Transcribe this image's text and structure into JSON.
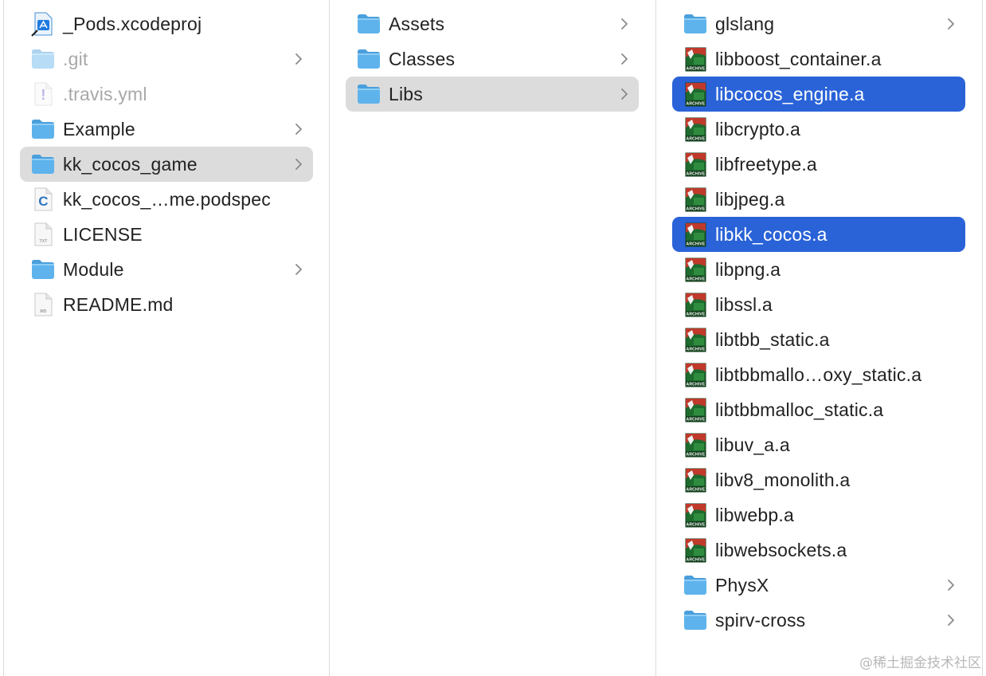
{
  "columns": [
    {
      "items": [
        {
          "label": "_Pods.xcodeproj",
          "icon": "xcodeproj-icon",
          "chevron": false,
          "dim": false,
          "selected": "none"
        },
        {
          "label": ".git",
          "icon": "folder-icon",
          "chevron": true,
          "dim": true,
          "selected": "none"
        },
        {
          "label": ".travis.yml",
          "icon": "yml-file-icon",
          "chevron": false,
          "dim": true,
          "selected": "none"
        },
        {
          "label": "Example",
          "icon": "folder-icon",
          "chevron": true,
          "dim": false,
          "selected": "none"
        },
        {
          "label": "kk_cocos_game",
          "icon": "folder-icon",
          "chevron": true,
          "dim": false,
          "selected": "gray"
        },
        {
          "label": "kk_cocos_…me.podspec",
          "icon": "podspec-file-icon",
          "chevron": false,
          "dim": false,
          "selected": "none"
        },
        {
          "label": "LICENSE",
          "icon": "text-file-icon",
          "chevron": false,
          "dim": false,
          "selected": "none"
        },
        {
          "label": "Module",
          "icon": "folder-icon",
          "chevron": true,
          "dim": false,
          "selected": "none"
        },
        {
          "label": "README.md",
          "icon": "text-file-icon",
          "chevron": false,
          "dim": false,
          "selected": "none"
        }
      ]
    },
    {
      "items": [
        {
          "label": "Assets",
          "icon": "folder-icon",
          "chevron": true,
          "dim": false,
          "selected": "none"
        },
        {
          "label": "Classes",
          "icon": "folder-icon",
          "chevron": true,
          "dim": false,
          "selected": "none"
        },
        {
          "label": "Libs",
          "icon": "folder-icon",
          "chevron": true,
          "dim": false,
          "selected": "gray"
        }
      ]
    },
    {
      "items": [
        {
          "label": "glslang",
          "icon": "folder-icon",
          "chevron": true,
          "dim": false,
          "selected": "none"
        },
        {
          "label": "libboost_container.a",
          "icon": "archive-icon",
          "chevron": false,
          "dim": false,
          "selected": "none"
        },
        {
          "label": "libcocos_engine.a",
          "icon": "archive-icon",
          "chevron": false,
          "dim": false,
          "selected": "blue"
        },
        {
          "label": "libcrypto.a",
          "icon": "archive-icon",
          "chevron": false,
          "dim": false,
          "selected": "none"
        },
        {
          "label": "libfreetype.a",
          "icon": "archive-icon",
          "chevron": false,
          "dim": false,
          "selected": "none"
        },
        {
          "label": "libjpeg.a",
          "icon": "archive-icon",
          "chevron": false,
          "dim": false,
          "selected": "none"
        },
        {
          "label": "libkk_cocos.a",
          "icon": "archive-icon",
          "chevron": false,
          "dim": false,
          "selected": "blue"
        },
        {
          "label": "libpng.a",
          "icon": "archive-icon",
          "chevron": false,
          "dim": false,
          "selected": "none"
        },
        {
          "label": "libssl.a",
          "icon": "archive-icon",
          "chevron": false,
          "dim": false,
          "selected": "none"
        },
        {
          "label": "libtbb_static.a",
          "icon": "archive-icon",
          "chevron": false,
          "dim": false,
          "selected": "none"
        },
        {
          "label": "libtbbmallo…oxy_static.a",
          "icon": "archive-icon",
          "chevron": false,
          "dim": false,
          "selected": "none"
        },
        {
          "label": "libtbbmalloc_static.a",
          "icon": "archive-icon",
          "chevron": false,
          "dim": false,
          "selected": "none"
        },
        {
          "label": "libuv_a.a",
          "icon": "archive-icon",
          "chevron": false,
          "dim": false,
          "selected": "none"
        },
        {
          "label": "libv8_monolith.a",
          "icon": "archive-icon",
          "chevron": false,
          "dim": false,
          "selected": "none"
        },
        {
          "label": "libwebp.a",
          "icon": "archive-icon",
          "chevron": false,
          "dim": false,
          "selected": "none"
        },
        {
          "label": "libwebsockets.a",
          "icon": "archive-icon",
          "chevron": false,
          "dim": false,
          "selected": "none"
        },
        {
          "label": "PhysX",
          "icon": "folder-icon",
          "chevron": true,
          "dim": false,
          "selected": "none"
        },
        {
          "label": "spirv-cross",
          "icon": "folder-icon",
          "chevron": true,
          "dim": false,
          "selected": "none"
        }
      ]
    }
  ],
  "icon_badges": {
    "podspec": "C",
    "text_file": "TXT",
    "markdown": "MD",
    "yml": "!",
    "archive": "ARCHIVE"
  },
  "watermark": "@稀土掘金技术社区",
  "colors": {
    "selection_blue": "#2a63d8",
    "selection_gray": "#dcdcdc",
    "folder_blue": "#5eb3ec",
    "dim_text": "#a8a8a8",
    "archive_green": "#1e6b2e",
    "archive_red": "#c0392b"
  }
}
